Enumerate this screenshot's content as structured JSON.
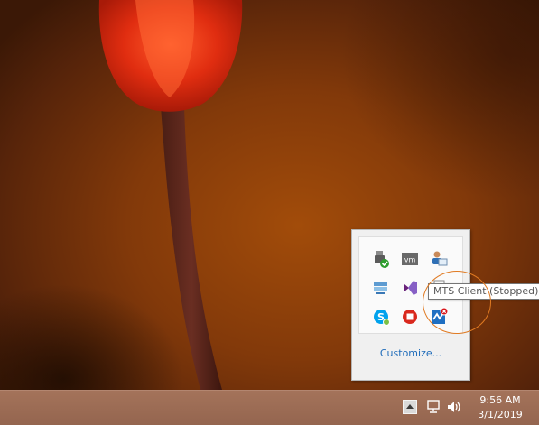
{
  "tray_flyout": {
    "icons": [
      {
        "name": "safely-remove-hardware-icon"
      },
      {
        "name": "vmware-icon",
        "label": "vm"
      },
      {
        "name": "user-network-icon"
      },
      {
        "name": "sync-icon"
      },
      {
        "name": "visual-studio-icon"
      },
      {
        "name": "document-icon"
      },
      {
        "name": "skype-icon"
      },
      {
        "name": "stop-record-icon"
      },
      {
        "name": "mts-client-icon"
      }
    ],
    "customize_label": "Customize..."
  },
  "tooltip": {
    "text": "MTS Client (Stopped)"
  },
  "taskbar": {
    "time": "9:56 AM",
    "date": "3/1/2019"
  },
  "colors": {
    "annotation": "#e07a22",
    "link": "#1f6cba",
    "taskbar": "#9a6a54"
  }
}
